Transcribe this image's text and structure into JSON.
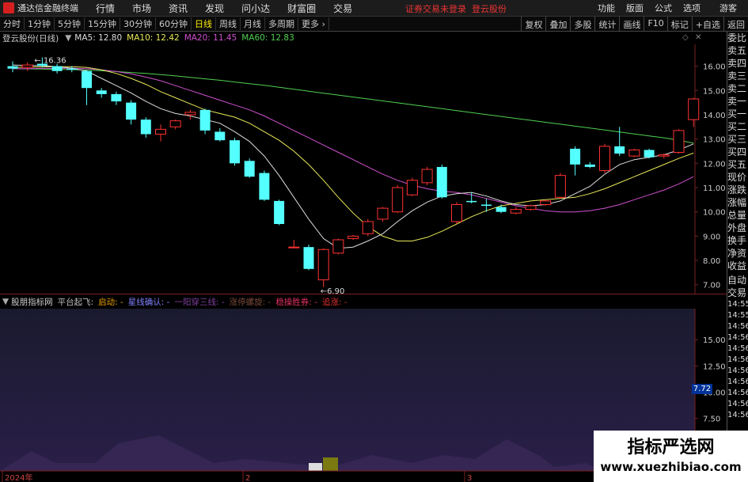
{
  "menubar": {
    "app_title": "通达信金融终端",
    "items": [
      "行情",
      "市场",
      "资讯",
      "发现",
      "问小达",
      "财富圈",
      "交易"
    ],
    "status": "证券交易未登录",
    "stock_link": "登云股份",
    "right_items": [
      "功能",
      "版面",
      "公式",
      "选项"
    ],
    "user": "游客"
  },
  "toolbar": {
    "periods": [
      "分时",
      "1分钟",
      "5分钟",
      "15分钟",
      "30分钟",
      "60分钟",
      "日线",
      "周线",
      "月线",
      "多周期",
      "更多"
    ],
    "active_period": "日线",
    "right_buttons": [
      "复权",
      "叠加",
      "多股",
      "统计",
      "画线",
      "F10",
      "标记",
      "+自选",
      "返回"
    ]
  },
  "legend": {
    "stock": "登云股份(日线)",
    "ma5": "MA5: 12.80",
    "ma10": "MA10: 12.42",
    "ma20": "MA20: 11.45",
    "ma60": "MA60: 12.83"
  },
  "chart_data": {
    "type": "candlestick",
    "title": "登云股份(日线)",
    "ylim": [
      6.6,
      16.9
    ],
    "yticks": [
      "16.00",
      "15.00",
      "14.00",
      "13.00",
      "12.00",
      "11.00",
      "10.00",
      "9.00",
      "8.00",
      "7.00"
    ],
    "ytick_values": [
      16,
      15,
      14,
      13,
      12,
      11,
      10,
      9,
      8,
      7
    ],
    "high_label": "16.36",
    "low_label": "6.90",
    "candles": [
      {
        "o": 16.0,
        "h": 16.2,
        "l": 15.75,
        "c": 15.9
      },
      {
        "o": 15.95,
        "h": 16.15,
        "l": 15.8,
        "c": 16.05
      },
      {
        "o": 16.1,
        "h": 16.36,
        "l": 15.95,
        "c": 16.02
      },
      {
        "o": 16.0,
        "h": 16.1,
        "l": 15.7,
        "c": 15.8
      },
      {
        "o": 15.9,
        "h": 16.0,
        "l": 15.75,
        "c": 15.85
      },
      {
        "o": 15.8,
        "h": 15.85,
        "l": 14.4,
        "c": 15.1
      },
      {
        "o": 15.0,
        "h": 15.1,
        "l": 14.7,
        "c": 14.85
      },
      {
        "o": 14.85,
        "h": 14.95,
        "l": 14.4,
        "c": 14.55
      },
      {
        "o": 14.5,
        "h": 14.6,
        "l": 13.6,
        "c": 13.8
      },
      {
        "o": 13.8,
        "h": 13.9,
        "l": 13.05,
        "c": 13.2
      },
      {
        "o": 13.2,
        "h": 13.6,
        "l": 12.9,
        "c": 13.4
      },
      {
        "o": 13.5,
        "h": 13.8,
        "l": 13.4,
        "c": 13.75
      },
      {
        "o": 14.0,
        "h": 14.2,
        "l": 13.8,
        "c": 14.1
      },
      {
        "o": 14.2,
        "h": 14.25,
        "l": 13.2,
        "c": 13.35
      },
      {
        "o": 13.3,
        "h": 13.45,
        "l": 12.9,
        "c": 12.95
      },
      {
        "o": 12.95,
        "h": 13.05,
        "l": 11.9,
        "c": 12.0
      },
      {
        "o": 12.1,
        "h": 12.2,
        "l": 11.4,
        "c": 11.45
      },
      {
        "o": 11.6,
        "h": 11.7,
        "l": 10.45,
        "c": 10.5
      },
      {
        "o": 10.45,
        "h": 10.5,
        "l": 9.45,
        "c": 9.5
      },
      {
        "o": 8.55,
        "h": 8.85,
        "l": 8.5,
        "c": 8.55
      },
      {
        "o": 8.55,
        "h": 8.65,
        "l": 7.6,
        "c": 7.65
      },
      {
        "o": 7.2,
        "h": 8.5,
        "l": 6.9,
        "c": 8.45
      },
      {
        "o": 8.3,
        "h": 8.9,
        "l": 8.25,
        "c": 8.85
      },
      {
        "o": 8.9,
        "h": 9.05,
        "l": 8.85,
        "c": 9.0
      },
      {
        "o": 9.1,
        "h": 9.7,
        "l": 9.0,
        "c": 9.6
      },
      {
        "o": 9.7,
        "h": 10.2,
        "l": 9.6,
        "c": 10.15
      },
      {
        "o": 10.0,
        "h": 11.1,
        "l": 9.95,
        "c": 11.0
      },
      {
        "o": 10.7,
        "h": 11.4,
        "l": 10.65,
        "c": 11.3
      },
      {
        "o": 11.2,
        "h": 11.85,
        "l": 11.1,
        "c": 11.75
      },
      {
        "o": 11.85,
        "h": 11.95,
        "l": 10.55,
        "c": 10.6
      },
      {
        "o": 9.6,
        "h": 10.4,
        "l": 9.5,
        "c": 10.3
      },
      {
        "o": 10.45,
        "h": 10.8,
        "l": 10.35,
        "c": 10.4
      },
      {
        "o": 10.3,
        "h": 10.55,
        "l": 10.0,
        "c": 10.25
      },
      {
        "o": 10.2,
        "h": 10.3,
        "l": 9.95,
        "c": 10.0
      },
      {
        "o": 9.95,
        "h": 10.2,
        "l": 9.9,
        "c": 10.1
      },
      {
        "o": 10.1,
        "h": 10.3,
        "l": 10.05,
        "c": 10.25
      },
      {
        "o": 10.3,
        "h": 10.5,
        "l": 10.25,
        "c": 10.45
      },
      {
        "o": 10.6,
        "h": 11.6,
        "l": 10.55,
        "c": 11.5
      },
      {
        "o": 12.6,
        "h": 12.7,
        "l": 11.5,
        "c": 11.95
      },
      {
        "o": 11.95,
        "h": 12.05,
        "l": 11.8,
        "c": 11.85
      },
      {
        "o": 11.7,
        "h": 12.8,
        "l": 11.6,
        "c": 12.7
      },
      {
        "o": 12.7,
        "h": 13.5,
        "l": 12.3,
        "c": 12.4
      },
      {
        "o": 12.3,
        "h": 12.6,
        "l": 12.25,
        "c": 12.55
      },
      {
        "o": 12.55,
        "h": 12.6,
        "l": 12.2,
        "c": 12.25
      },
      {
        "o": 12.3,
        "h": 12.4,
        "l": 12.2,
        "c": 12.35
      },
      {
        "o": 12.45,
        "h": 13.4,
        "l": 12.4,
        "c": 13.35
      },
      {
        "o": 13.8,
        "h": 14.7,
        "l": 13.5,
        "c": 14.65
      }
    ],
    "ma5": [
      16.05,
      16.03,
      16.02,
      15.98,
      15.92,
      15.8,
      15.5,
      15.2,
      14.9,
      14.55,
      14.25,
      14.05,
      13.95,
      13.8,
      13.65,
      13.3,
      12.9,
      12.3,
      11.5,
      10.6,
      9.7,
      8.9,
      8.5,
      8.55,
      8.8,
      9.1,
      9.6,
      10.05,
      10.4,
      10.65,
      10.75,
      10.8,
      10.65,
      10.45,
      10.3,
      10.25,
      10.3,
      10.45,
      10.75,
      11.05,
      11.55,
      11.95,
      12.15,
      12.25,
      12.35,
      12.55,
      12.8
    ],
    "ma10": [
      15.95,
      15.96,
      15.97,
      15.98,
      15.98,
      15.95,
      15.85,
      15.7,
      15.5,
      15.25,
      14.95,
      14.7,
      14.45,
      14.2,
      14.05,
      13.9,
      13.65,
      13.3,
      12.95,
      12.5,
      11.95,
      11.3,
      10.6,
      9.95,
      9.4,
      9.0,
      8.8,
      8.8,
      8.95,
      9.2,
      9.5,
      9.8,
      10.05,
      10.25,
      10.35,
      10.45,
      10.5,
      10.55,
      10.6,
      10.75,
      10.95,
      11.2,
      11.45,
      11.7,
      11.95,
      12.2,
      12.42
    ],
    "ma20": [
      15.9,
      15.9,
      15.91,
      15.91,
      15.92,
      15.9,
      15.85,
      15.78,
      15.68,
      15.55,
      15.4,
      15.2,
      15.0,
      14.8,
      14.6,
      14.4,
      14.2,
      13.95,
      13.65,
      13.35,
      13.05,
      12.75,
      12.45,
      12.15,
      11.85,
      11.55,
      11.3,
      11.1,
      10.95,
      10.85,
      10.8,
      10.7,
      10.55,
      10.4,
      10.25,
      10.15,
      10.05,
      10.0,
      10.0,
      10.05,
      10.15,
      10.3,
      10.5,
      10.7,
      10.9,
      11.15,
      11.45
    ],
    "ma60": [
      15.9,
      15.89,
      15.88,
      15.87,
      15.86,
      15.84,
      15.81,
      15.78,
      15.74,
      15.7,
      15.65,
      15.6,
      15.54,
      15.48,
      15.42,
      15.35,
      15.28,
      15.21,
      15.13,
      15.05,
      14.97,
      14.89,
      14.81,
      14.73,
      14.65,
      14.57,
      14.49,
      14.41,
      14.33,
      14.25,
      14.17,
      14.09,
      14.01,
      13.93,
      13.85,
      13.77,
      13.69,
      13.61,
      13.53,
      13.45,
      13.37,
      13.29,
      13.21,
      13.13,
      13.05,
      12.95,
      12.83
    ]
  },
  "indicator": {
    "name": "股朋指标网",
    "items": [
      {
        "label": "平台起飞:",
        "color": "#bbbbbb"
      },
      {
        "label": "启动:",
        "color": "#e8a000"
      },
      {
        "label": "星线确认:",
        "color": "#8080ff"
      },
      {
        "label": "一阳穿三线:",
        "color": "#8040a0"
      },
      {
        "label": "涨停螺旋:",
        "color": "#7a4a3a"
      },
      {
        "label": "稳操胜券:",
        "color": "#e03060"
      },
      {
        "label": "追涨:",
        "color": "#e03030"
      }
    ],
    "yticks": [
      "15.00",
      "12.50",
      "10.00",
      "7.50",
      "5.00"
    ],
    "ytick_values": [
      15,
      12.5,
      10,
      7.5,
      5
    ],
    "ylim": [
      2.5,
      17.5
    ],
    "current_value": "7.72"
  },
  "x_axis": {
    "labels": [
      "2024年",
      "2",
      "3"
    ]
  },
  "right_panel": {
    "items": [
      "委比",
      "卖五",
      "卖四",
      "卖三",
      "卖二",
      "卖一",
      "买一",
      "买二",
      "买三",
      "买四",
      "买五",
      "现价",
      "涨跌",
      "涨幅",
      "总量",
      "外盘",
      "换手",
      "净资",
      "收益",
      "自动",
      "交易"
    ],
    "times": [
      "14:55",
      "14:55",
      "14:56",
      "14:56",
      "14:56",
      "14:56",
      "14:56",
      "14:56",
      "14:56",
      "14:56",
      "14:56"
    ]
  },
  "watermark": {
    "title": "指标严选网",
    "url": "www.xuezhibiao.com"
  },
  "colors": {
    "up": "#ff3232",
    "down": "#54ffff",
    "ma5": "#dddddd",
    "ma10": "#e8e858",
    "ma20": "#d050d0",
    "ma60": "#50d050"
  }
}
